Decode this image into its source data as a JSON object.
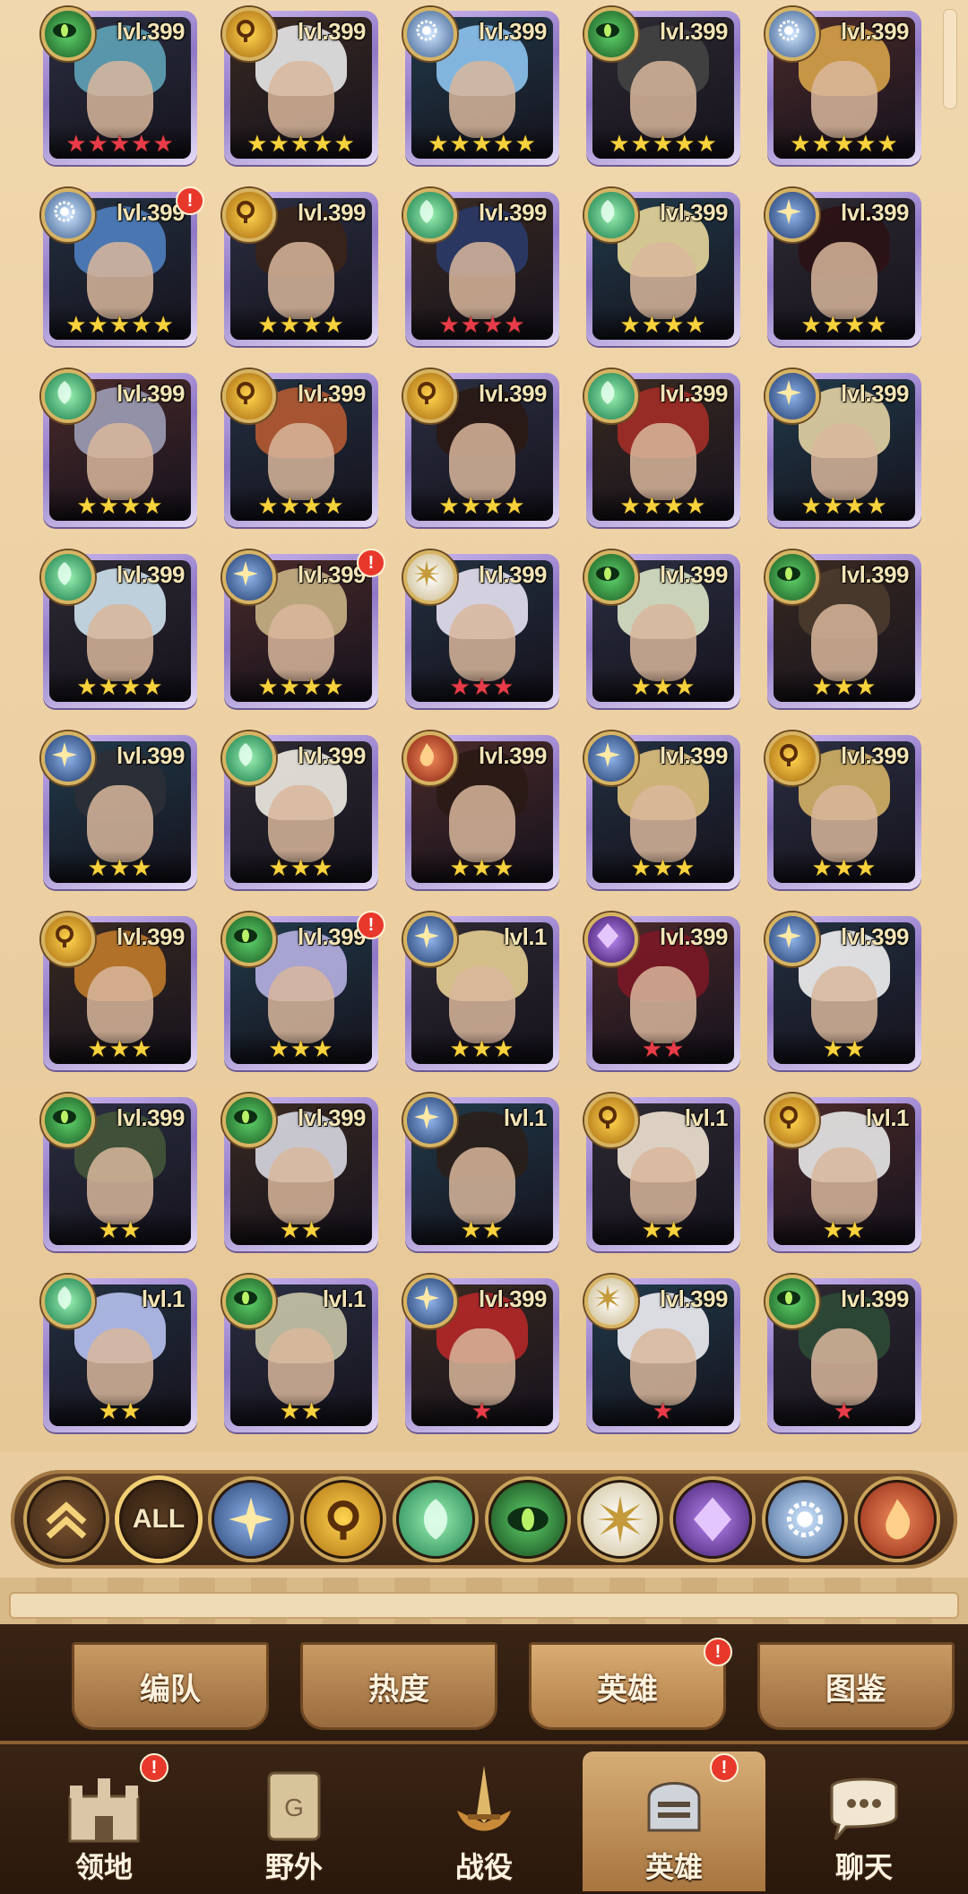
{
  "heroes": [
    {
      "level": "lvl.399",
      "faction": "wilder",
      "stars": 5,
      "star_color": "red",
      "alert": false,
      "hair": "#5fa3b8"
    },
    {
      "level": "lvl.399",
      "faction": "graveborn",
      "stars": 5,
      "star_color": "gold",
      "alert": false,
      "hair": "#e9e9e9"
    },
    {
      "level": "lvl.399",
      "faction": "dimensional",
      "stars": 5,
      "star_color": "gold",
      "alert": false,
      "hair": "#8ec4ef"
    },
    {
      "level": "lvl.399",
      "faction": "wilder",
      "stars": 5,
      "star_color": "gold",
      "alert": false,
      "hair": "#444"
    },
    {
      "level": "lvl.399",
      "faction": "dimensional",
      "stars": 5,
      "star_color": "gold",
      "alert": false,
      "hair": "#d7a24a"
    },
    {
      "level": "lvl.399",
      "faction": "dimensional",
      "stars": 5,
      "star_color": "gold",
      "alert": true,
      "hair": "#4f7fbf"
    },
    {
      "level": "lvl.399",
      "faction": "graveborn",
      "stars": 4,
      "star_color": "gold",
      "alert": false,
      "hair": "#3a2418"
    },
    {
      "level": "lvl.399",
      "faction": "maulers",
      "stars": 4,
      "star_color": "red",
      "alert": false,
      "hair": "#2a3a68"
    },
    {
      "level": "lvl.399",
      "faction": "maulers",
      "stars": 4,
      "star_color": "gold",
      "alert": false,
      "hair": "#e8d79c"
    },
    {
      "level": "lvl.399",
      "faction": "lightbearer",
      "stars": 4,
      "star_color": "gold",
      "alert": false,
      "hair": "#2b1214"
    },
    {
      "level": "lvl.399",
      "faction": "maulers",
      "stars": 4,
      "star_color": "gold",
      "alert": false,
      "hair": "#9d9db6"
    },
    {
      "level": "lvl.399",
      "faction": "graveborn",
      "stars": 4,
      "star_color": "gold",
      "alert": false,
      "hair": "#b55a32"
    },
    {
      "level": "lvl.399",
      "faction": "graveborn",
      "stars": 4,
      "star_color": "gold",
      "alert": false,
      "hair": "#2a1a14"
    },
    {
      "level": "lvl.399",
      "faction": "maulers",
      "stars": 4,
      "star_color": "gold",
      "alert": false,
      "hair": "#a22e26"
    },
    {
      "level": "lvl.399",
      "faction": "lightbearer",
      "stars": 4,
      "star_color": "gold",
      "alert": false,
      "hair": "#e3d3a4"
    },
    {
      "level": "lvl.399",
      "faction": "maulers",
      "stars": 4,
      "star_color": "gold",
      "alert": false,
      "hair": "#cfe3ef"
    },
    {
      "level": "lvl.399",
      "faction": "lightbearer",
      "stars": 4,
      "star_color": "gold",
      "alert": true,
      "hair": "#c9b386"
    },
    {
      "level": "lvl.399",
      "faction": "celestial",
      "stars": 3,
      "star_color": "red",
      "alert": false,
      "hair": "#e7e3f3"
    },
    {
      "level": "lvl.399",
      "faction": "wilder",
      "stars": 3,
      "star_color": "gold",
      "alert": false,
      "hair": "#dde6c8"
    },
    {
      "level": "lvl.399",
      "faction": "wilder",
      "stars": 3,
      "star_color": "gold",
      "alert": false,
      "hair": "#4b3b2e"
    },
    {
      "level": "lvl.399",
      "faction": "lightbearer",
      "stars": 3,
      "star_color": "gold",
      "alert": false,
      "hair": "#2c2f36"
    },
    {
      "level": "lvl.399",
      "faction": "maulers",
      "stars": 3,
      "star_color": "gold",
      "alert": false,
      "hair": "#f0ece4"
    },
    {
      "level": "lvl.399",
      "faction": "hypogean",
      "stars": 3,
      "star_color": "gold",
      "alert": false,
      "hair": "#2a1a14"
    },
    {
      "level": "lvl.399",
      "faction": "lightbearer",
      "stars": 3,
      "star_color": "gold",
      "alert": false,
      "hair": "#e0c27e"
    },
    {
      "level": "lvl.399",
      "faction": "graveborn",
      "stars": 3,
      "star_color": "gold",
      "alert": false,
      "hair": "#d4b166"
    },
    {
      "level": "lvl.399",
      "faction": "graveborn",
      "stars": 3,
      "star_color": "gold",
      "alert": false,
      "hair": "#c07a2a"
    },
    {
      "level": "lvl.399",
      "faction": "wilder",
      "stars": 3,
      "star_color": "gold",
      "alert": true,
      "hair": "#b7b1e2"
    },
    {
      "level": "lvl.1",
      "faction": "lightbearer",
      "stars": 3,
      "star_color": "gold",
      "alert": false,
      "hair": "#e7cf94"
    },
    {
      "level": "lvl.399",
      "faction": "mauler-purple",
      "stars": 2,
      "star_color": "red",
      "alert": false,
      "hair": "#7a1826"
    },
    {
      "level": "lvl.399",
      "faction": "lightbearer",
      "stars": 2,
      "star_color": "gold",
      "alert": false,
      "hair": "#f2f2f2"
    },
    {
      "level": "lvl.399",
      "faction": "wilder",
      "stars": 2,
      "star_color": "gold",
      "alert": false,
      "hair": "#44553a"
    },
    {
      "level": "lvl.399",
      "faction": "wilder",
      "stars": 2,
      "star_color": "gold",
      "alert": false,
      "hair": "#d8d8e2"
    },
    {
      "level": "lvl.1",
      "faction": "lightbearer",
      "stars": 2,
      "star_color": "gold",
      "alert": false,
      "hair": "#2a1f1a"
    },
    {
      "level": "lvl.1",
      "faction": "graveborn",
      "stars": 2,
      "star_color": "gold",
      "alert": false,
      "hair": "#efe3d3"
    },
    {
      "level": "lvl.1",
      "faction": "graveborn",
      "stars": 2,
      "star_color": "gold",
      "alert": false,
      "hair": "#e8e8e8"
    },
    {
      "level": "lvl.1",
      "faction": "maulers",
      "stars": 2,
      "star_color": "gold",
      "alert": false,
      "hair": "#b7c2f1"
    },
    {
      "level": "lvl.1",
      "faction": "wilder",
      "stars": 2,
      "star_color": "gold",
      "alert": false,
      "hair": "#c9c5a8"
    },
    {
      "level": "lvl.399",
      "faction": "lightbearer",
      "stars": 1,
      "star_color": "red",
      "alert": false,
      "hair": "#b52828"
    },
    {
      "level": "lvl.399",
      "faction": "celestial",
      "stars": 1,
      "star_color": "red",
      "alert": false,
      "hair": "#f0f0f4"
    },
    {
      "level": "lvl.399",
      "faction": "wilder",
      "stars": 1,
      "star_color": "red",
      "alert": false,
      "hair": "#2e4a36"
    }
  ],
  "alert_mark": "!",
  "filter": {
    "all_label": "ALL",
    "buttons": [
      "collapse",
      "all",
      "lightbearer",
      "graveborn",
      "maulers",
      "wilder",
      "celestial",
      "hypogean",
      "dimensional",
      "fire"
    ]
  },
  "subtabs": [
    {
      "label": "编队",
      "active": false,
      "alert": false
    },
    {
      "label": "热度",
      "active": false,
      "alert": false
    },
    {
      "label": "英雄",
      "active": true,
      "alert": true
    },
    {
      "label": "图鉴",
      "active": false,
      "alert": false
    }
  ],
  "nav": [
    {
      "label": "领地",
      "icon": "castle-icon",
      "active": false,
      "alert": true
    },
    {
      "label": "野外",
      "icon": "scroll-map-icon",
      "active": false,
      "alert": false
    },
    {
      "label": "战役",
      "icon": "sword-crest-icon",
      "active": false,
      "alert": false
    },
    {
      "label": "英雄",
      "icon": "knight-helmet-icon",
      "active": true,
      "alert": true
    },
    {
      "label": "聊天",
      "icon": "chat-bubble-icon",
      "active": false,
      "alert": false
    }
  ],
  "colors": {
    "star_gold": "#f7d23c",
    "star_red": "#ea3b4a",
    "frame_purple": "#8f78c6",
    "alert_red": "#e8382c"
  }
}
